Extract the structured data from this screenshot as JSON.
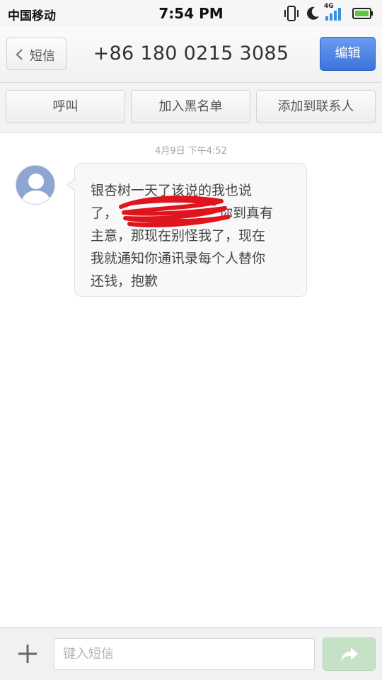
{
  "status_bar": {
    "carrier": "中国移动",
    "time": "7:54 PM",
    "network_label": "4G",
    "icons": [
      "vibrate-icon",
      "moon-icon",
      "signal-icon",
      "battery-icon"
    ]
  },
  "header": {
    "back_label": "短信",
    "title": "+86 180 0215 3085",
    "edit_label": "编辑"
  },
  "actions": {
    "call_label": "呼叫",
    "blacklist_label": "加入黑名单",
    "add_contact_label": "添加到联系人"
  },
  "conversation": {
    "timestamp": "4月9日 下午4:52",
    "messages": [
      {
        "line1": "银杏树一天了该说的我也说",
        "line2_start": "了，",
        "line2_end": "你到真有",
        "line3": "主意，那现在别怪我了，现在",
        "line4": "我就通知你通讯录每个人替你",
        "line5": "还钱，抱歉"
      }
    ]
  },
  "input_bar": {
    "placeholder": "键入短信"
  },
  "colors": {
    "edit_button": "#3a73dc",
    "send_button": "#c6e2c6",
    "redaction": "#e0141c"
  }
}
